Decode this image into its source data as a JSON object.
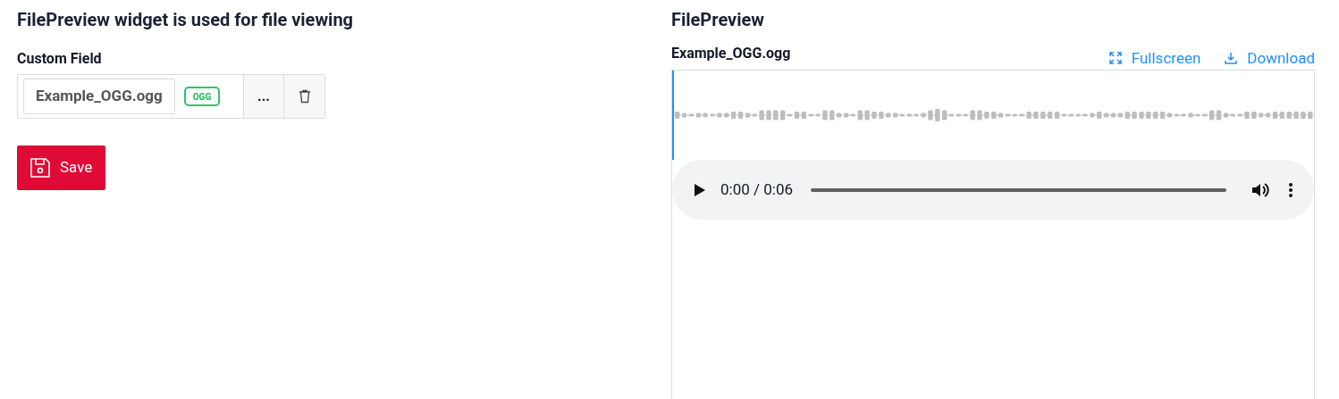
{
  "left": {
    "title": "FilePreview widget is used for file viewing",
    "field": {
      "label": "Custom Field",
      "file_name": "Example_OGG.ogg",
      "badge": "OGG",
      "more": "...",
      "save": "Save"
    }
  },
  "right": {
    "title": "FilePreview",
    "file_name": "Example_OGG.ogg",
    "actions": [
      {
        "kind": "fullscreen",
        "label": "Fullscreen"
      },
      {
        "kind": "download",
        "label": "Download"
      }
    ],
    "player": {
      "time": "0:00 / 0:06"
    }
  }
}
